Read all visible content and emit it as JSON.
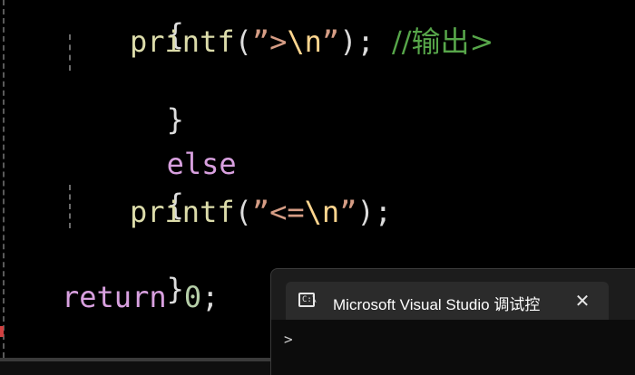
{
  "editor": {
    "lines": {
      "brace_open_1": "{",
      "printf1_fn": "printf",
      "printf1_open": "(",
      "printf1_str_a": "”>",
      "printf1_esc": "\\n",
      "printf1_str_b": "”",
      "printf1_close": ");",
      "printf1_comment": "//输出>",
      "brace_close_1": "}",
      "else_kw": "else",
      "brace_open_2": "{",
      "printf2_fn": "printf",
      "printf2_open": "(",
      "printf2_str_a": "”<=",
      "printf2_esc": "\\n",
      "printf2_str_b": "”",
      "printf2_close": ");",
      "brace_close_2": "}",
      "return_kw": "return",
      "return_val": "0",
      "return_semi": ";"
    }
  },
  "console": {
    "icon_text": "C:\\",
    "tab_title": "Microsoft Visual Studio 调试控",
    "close_symbol": "✕",
    "prompt": ">"
  },
  "colors": {
    "background": "#000000",
    "function": "#dcdcaa",
    "string": "#d69d85",
    "keyword": "#d8a0df",
    "comment": "#57a64a",
    "number": "#b5cea8"
  }
}
